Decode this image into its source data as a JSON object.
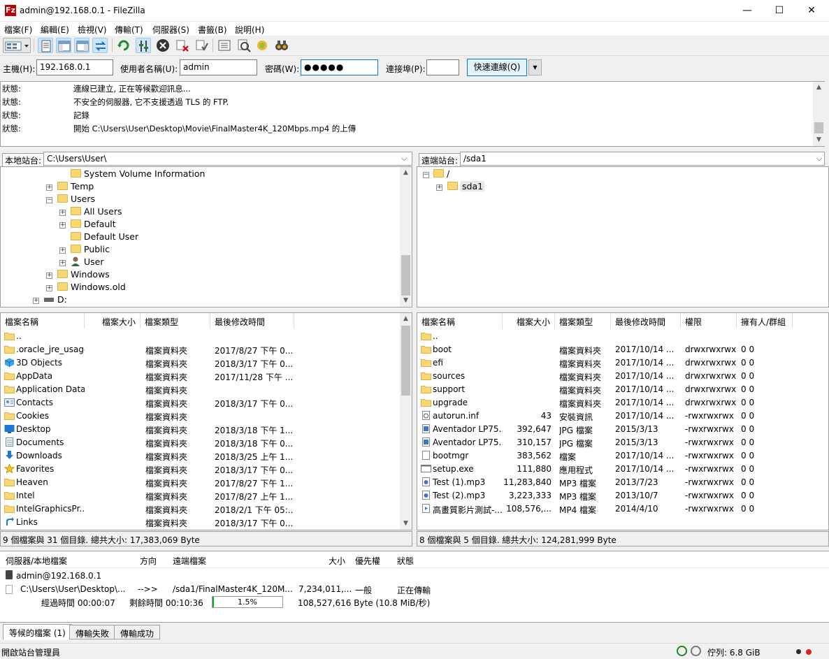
{
  "window": {
    "title": "admin@192.168.0.1 - FileZilla",
    "app_icon": "Fz",
    "minimize": "—",
    "maximize": "☐",
    "close": "✕"
  },
  "menu": [
    "檔案(F)",
    "編輯(E)",
    "檢視(V)",
    "傳輸(T)",
    "伺服器(S)",
    "書籤(B)",
    "說明(H)"
  ],
  "quickconnect": {
    "host_label": "主機(H):",
    "host_value": "192.168.0.1",
    "user_label": "使用者名稱(U):",
    "user_value": "admin",
    "pass_label": "密碼(W):",
    "pass_value": "●●●●●",
    "port_label": "連接埠(P):",
    "port_value": "",
    "connect_button": "快速連線(Q)",
    "dropdown": "▼"
  },
  "log": [
    {
      "k": "狀態:",
      "v": "連線已建立, 正在等候歡迎訊息..."
    },
    {
      "k": "狀態:",
      "v": "不安全的伺服器, 它不支援透過 TLS 的 FTP."
    },
    {
      "k": "狀態:",
      "v": "記錄"
    },
    {
      "k": "狀態:",
      "v": "開始 C:\\Users\\User\\Desktop\\Movie\\FinalMaster4K_120Mbps.mp4 的上傳"
    }
  ],
  "local": {
    "site_label": "本地站台:",
    "path": "C:\\Users\\User\\",
    "tree": [
      "System Volume Information",
      "Temp",
      "Users",
      "All Users",
      "Default",
      "Default User",
      "Public",
      "User",
      "Windows",
      "Windows.old",
      "D:"
    ],
    "headers": [
      "檔案名稱",
      "檔案大小",
      "檔案類型",
      "最後修改時間"
    ],
    "files": [
      {
        "name": "..",
        "size": "",
        "type": "",
        "mod": "",
        "icon": "folder"
      },
      {
        "name": ".oracle_jre_usage",
        "size": "",
        "type": "檔案資料夾",
        "mod": "2017/8/27 下午 0...",
        "icon": "folder"
      },
      {
        "name": "3D Objects",
        "size": "",
        "type": "檔案資料夾",
        "mod": "2018/3/17 下午 0...",
        "icon": "3d"
      },
      {
        "name": "AppData",
        "size": "",
        "type": "檔案資料夾",
        "mod": "2017/11/28 下午 ...",
        "icon": "folder"
      },
      {
        "name": "Application Data",
        "size": "",
        "type": "檔案資料夾",
        "mod": "",
        "icon": "folder"
      },
      {
        "name": "Contacts",
        "size": "",
        "type": "檔案資料夾",
        "mod": "2018/3/17 下午 0...",
        "icon": "contacts"
      },
      {
        "name": "Cookies",
        "size": "",
        "type": "檔案資料夾",
        "mod": "",
        "icon": "folder"
      },
      {
        "name": "Desktop",
        "size": "",
        "type": "檔案資料夾",
        "mod": "2018/3/18 下午 1...",
        "icon": "desktop"
      },
      {
        "name": "Documents",
        "size": "",
        "type": "檔案資料夾",
        "mod": "2018/3/18 下午 0...",
        "icon": "documents"
      },
      {
        "name": "Downloads",
        "size": "",
        "type": "檔案資料夾",
        "mod": "2018/3/25 上午 1...",
        "icon": "downloads"
      },
      {
        "name": "Favorites",
        "size": "",
        "type": "檔案資料夾",
        "mod": "2018/3/17 下午 0...",
        "icon": "star"
      },
      {
        "name": "Heaven",
        "size": "",
        "type": "檔案資料夾",
        "mod": "2017/8/27 下午 1...",
        "icon": "folder"
      },
      {
        "name": "Intel",
        "size": "",
        "type": "檔案資料夾",
        "mod": "2017/8/27 上午 1...",
        "icon": "folder"
      },
      {
        "name": "IntelGraphicsPr...",
        "size": "",
        "type": "檔案資料夾",
        "mod": "2018/2/1 下午 05:...",
        "icon": "folder"
      },
      {
        "name": "Links",
        "size": "",
        "type": "檔案資料夾",
        "mod": "2018/3/17 下午 0...",
        "icon": "links"
      }
    ],
    "status": "9 個檔案與 31 個目錄. 總共大小: 17,383,069 Byte"
  },
  "remote": {
    "site_label": "遠端站台:",
    "path": "/sda1",
    "tree": [
      "/",
      "sda1"
    ],
    "headers": [
      "檔案名稱",
      "檔案大小",
      "檔案類型",
      "最後修改時間",
      "權限",
      "擁有人/群組"
    ],
    "files": [
      {
        "name": "..",
        "size": "",
        "type": "",
        "mod": "",
        "perm": "",
        "owner": "",
        "icon": "folder"
      },
      {
        "name": "boot",
        "size": "",
        "type": "檔案資料夾",
        "mod": "2017/10/14 ...",
        "perm": "drwxrwxrwx",
        "owner": "0 0",
        "icon": "folder"
      },
      {
        "name": "efi",
        "size": "",
        "type": "檔案資料夾",
        "mod": "2017/10/14 ...",
        "perm": "drwxrwxrwx",
        "owner": "0 0",
        "icon": "folder"
      },
      {
        "name": "sources",
        "size": "",
        "type": "檔案資料夾",
        "mod": "2017/10/14 ...",
        "perm": "drwxrwxrwx",
        "owner": "0 0",
        "icon": "folder"
      },
      {
        "name": "support",
        "size": "",
        "type": "檔案資料夾",
        "mod": "2017/10/14 ...",
        "perm": "drwxrwxrwx",
        "owner": "0 0",
        "icon": "folder"
      },
      {
        "name": "upgrade",
        "size": "",
        "type": "檔案資料夾",
        "mod": "2017/10/14 ...",
        "perm": "drwxrwxrwx",
        "owner": "0 0",
        "icon": "folder"
      },
      {
        "name": "autorun.inf",
        "size": "43",
        "type": "安裝資訊",
        "mod": "2017/10/14 ...",
        "perm": "-rwxrwxrwx",
        "owner": "0 0",
        "icon": "inf"
      },
      {
        "name": "Aventador LP75...",
        "size": "392,647",
        "type": "JPG 檔案",
        "mod": "2015/3/13",
        "perm": "-rwxrwxrwx",
        "owner": "0 0",
        "icon": "image"
      },
      {
        "name": "Aventador LP75...",
        "size": "310,157",
        "type": "JPG 檔案",
        "mod": "2015/3/13",
        "perm": "-rwxrwxrwx",
        "owner": "0 0",
        "icon": "image"
      },
      {
        "name": "bootmgr",
        "size": "383,562",
        "type": "檔案",
        "mod": "2017/10/14 ...",
        "perm": "-rwxrwxrwx",
        "owner": "0 0",
        "icon": "file"
      },
      {
        "name": "setup.exe",
        "size": "111,880",
        "type": "應用程式",
        "mod": "2017/10/14 ...",
        "perm": "-rwxrwxrwx",
        "owner": "0 0",
        "icon": "exe"
      },
      {
        "name": "Test (1).mp3",
        "size": "11,283,840",
        "type": "MP3 檔案",
        "mod": "2013/7/23",
        "perm": "-rwxrwxrwx",
        "owner": "0 0",
        "icon": "media"
      },
      {
        "name": "Test (2).mp3",
        "size": "3,223,333",
        "type": "MP3 檔案",
        "mod": "2013/10/7",
        "perm": "-rwxrwxrwx",
        "owner": "0 0",
        "icon": "media"
      },
      {
        "name": "高畫質影片測試-...",
        "size": "108,576,...",
        "type": "MP4 檔案",
        "mod": "2014/4/10",
        "perm": "-rwxrwxrwx",
        "owner": "0 0",
        "icon": "video"
      }
    ],
    "status": "8 個檔案與 5 個目錄. 總共大小: 124,281,999 Byte"
  },
  "queue": {
    "headers": [
      "伺服器/本地檔案",
      "方向",
      "遠端檔案",
      "大小",
      "優先權",
      "狀態"
    ],
    "server": "admin@192.168.0.1",
    "local_file": "C:\\Users\\User\\Desktop\\...",
    "direction": "-->>",
    "remote_file": "/sda1/FinalMaster4K_120M...",
    "size": "7,234,011,...",
    "priority": "一般",
    "state": "正在傳輸",
    "elapsed": "經過時間 00:00:07",
    "remaining": "剩餘時間 00:10:36",
    "progress_label": "1.5%",
    "progress": 0.015,
    "transferred": "108,527,616 Byte (10.8 MiB/秒)"
  },
  "tabs": [
    "等候的檔案 (1)",
    "傳輸失敗",
    "傳輸成功"
  ],
  "statusbar": {
    "left": "開啟站台管理員",
    "queue": "佇列: 6.8 GiB"
  }
}
